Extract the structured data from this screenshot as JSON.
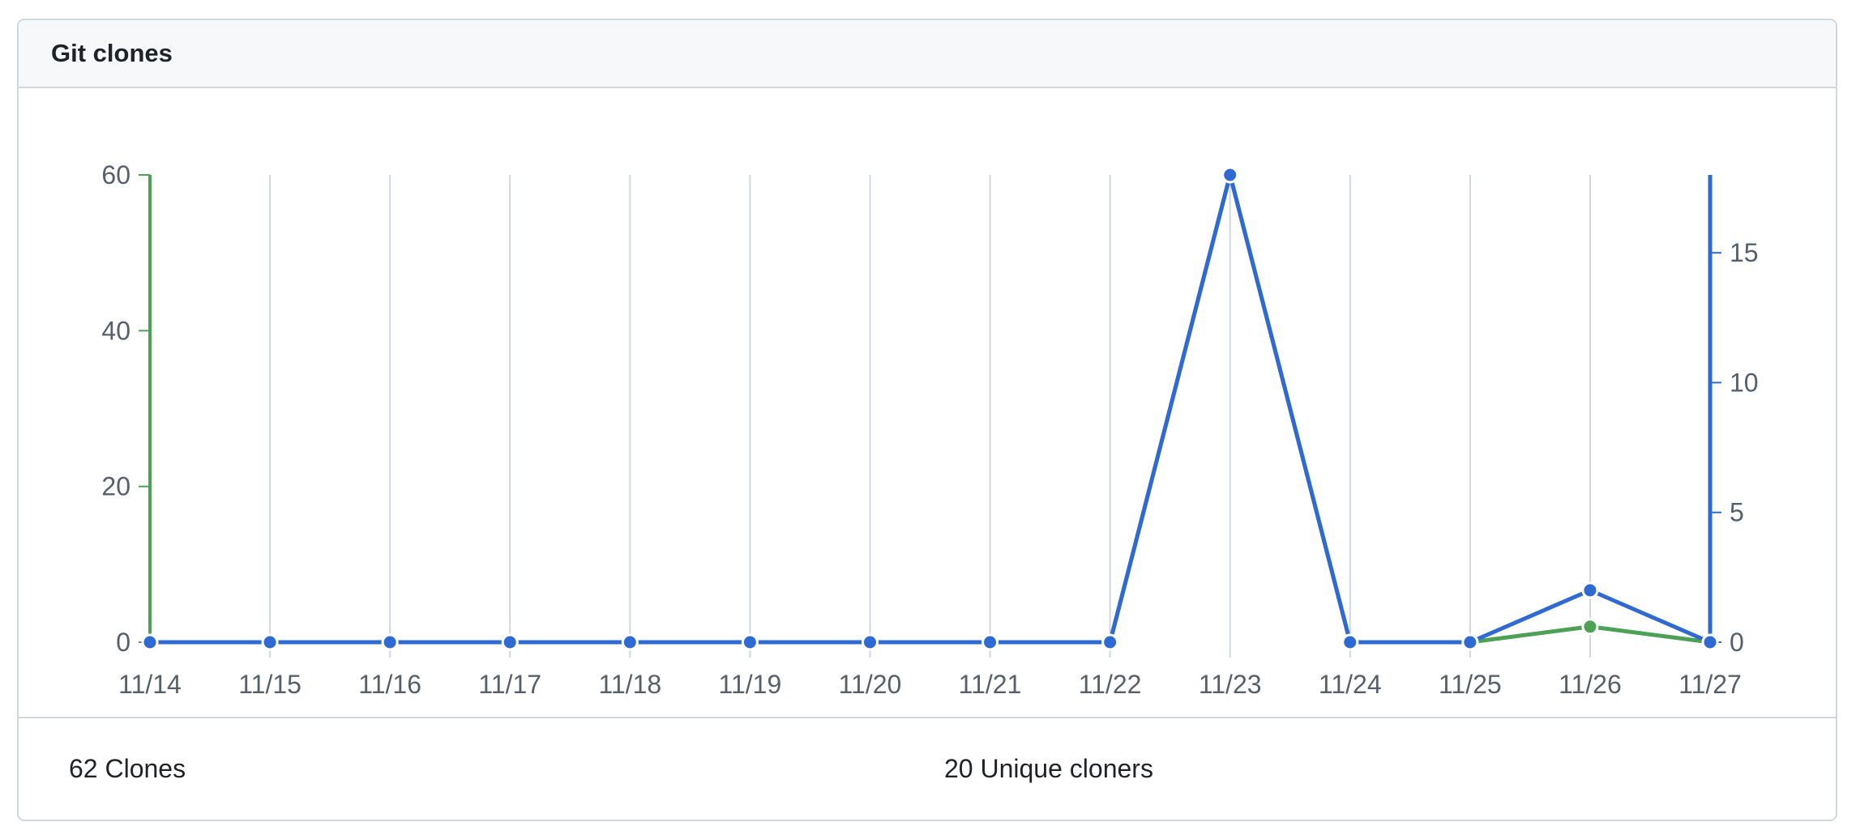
{
  "panel": {
    "title": "Git clones"
  },
  "summary": {
    "clones_label": "62 Clones",
    "unique_label": "20 Unique cloners"
  },
  "colors": {
    "clones": "#4ca154",
    "unique": "#2f6ad3",
    "grid": "#d0d7de",
    "axis_text": "#57606a"
  },
  "chart_data": {
    "type": "line",
    "title": "",
    "xlabel": "",
    "x": [
      "11/14",
      "11/15",
      "11/16",
      "11/17",
      "11/18",
      "11/19",
      "11/20",
      "11/21",
      "11/22",
      "11/23",
      "11/24",
      "11/25",
      "11/26",
      "11/27"
    ],
    "left_axis": {
      "ticks": [
        0,
        20,
        40,
        60
      ],
      "ylim": [
        0,
        60
      ]
    },
    "right_axis": {
      "ticks": [
        0,
        5,
        10,
        15
      ],
      "ylim": [
        0,
        18
      ]
    },
    "series": [
      {
        "axis": "left",
        "color": "#4ca154",
        "values": [
          0,
          0,
          0,
          0,
          0,
          0,
          0,
          0,
          0,
          60,
          0,
          0,
          2,
          0
        ]
      },
      {
        "axis": "right",
        "color": "#2f6ad3",
        "values": [
          0,
          0,
          0,
          0,
          0,
          0,
          0,
          0,
          0,
          18,
          0,
          0,
          2,
          0
        ]
      }
    ],
    "grid": true
  }
}
